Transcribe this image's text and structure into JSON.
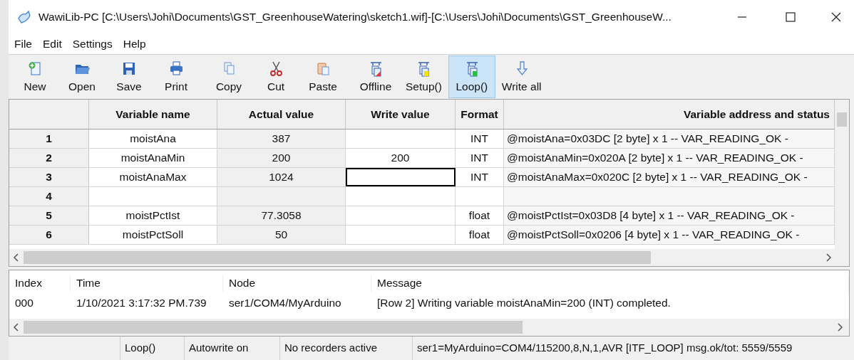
{
  "window": {
    "title": "WawiLib-PC [C:\\Users\\Johi\\Documents\\GST_GreenhouseWatering\\sketch1.wif]-[C:\\Users\\Johi\\Documents\\GST_GreenhouseW..."
  },
  "menu": [
    "File",
    "Edit",
    "Settings",
    "Help"
  ],
  "toolbar": [
    {
      "label": "New",
      "kind": "new",
      "selected": false
    },
    {
      "label": "Open",
      "kind": "open",
      "selected": false
    },
    {
      "label": "Save",
      "kind": "save",
      "selected": false
    },
    {
      "label": "Print",
      "kind": "print",
      "selected": false
    },
    {
      "label": "Copy",
      "kind": "copy",
      "selected": false
    },
    {
      "label": "Cut",
      "kind": "cut",
      "selected": false
    },
    {
      "label": "Paste",
      "kind": "paste",
      "selected": false
    },
    {
      "label": "Offline",
      "kind": "offline",
      "selected": false
    },
    {
      "label": "Setup()",
      "kind": "setup",
      "selected": false
    },
    {
      "label": "Loop()",
      "kind": "loop",
      "selected": true
    },
    {
      "label": "Write all",
      "kind": "writeall",
      "selected": false
    }
  ],
  "table": {
    "columns": [
      "Variable name",
      "Actual value",
      "Write value",
      "Format",
      "Variable address and status"
    ],
    "rows": [
      {
        "index": "1",
        "name": "moistAna",
        "actual": "387",
        "write": "",
        "write_focused": false,
        "format": "INT",
        "address": "@moistAna=0x03DC [2 byte] x 1 -- VAR_READING_OK -"
      },
      {
        "index": "2",
        "name": "moistAnaMin",
        "actual": "200",
        "write": "200",
        "write_focused": false,
        "format": "INT",
        "address": "@moistAnaMin=0x020A [2 byte] x 1 -- VAR_READING_OK -"
      },
      {
        "index": "3",
        "name": "moistAnaMax",
        "actual": "1024",
        "write": "",
        "write_focused": true,
        "format": "INT",
        "address": "@moistAnaMax=0x020C [2 byte] x 1 -- VAR_READING_OK -"
      },
      {
        "index": "4",
        "name": "",
        "actual": "",
        "write": "",
        "write_focused": false,
        "format": "",
        "address": ""
      },
      {
        "index": "5",
        "name": "moistPctIst",
        "actual": "77.3058",
        "write": "",
        "write_focused": false,
        "format": "float",
        "address": "@moistPctIst=0x03D8 [4 byte] x 1 -- VAR_READING_OK -"
      },
      {
        "index": "6",
        "name": "moistPctSoll",
        "actual": "50",
        "write": "",
        "write_focused": false,
        "format": "float",
        "address": "@moistPctSoll=0x0206 [4 byte] x 1 -- VAR_READING_OK -"
      }
    ]
  },
  "log": {
    "columns": [
      "Index",
      "Time",
      "Node",
      "Message"
    ],
    "rows": [
      [
        "000",
        "1/10/2021 3:17:32 PM.739",
        "ser1/COM4/MyArduino",
        "[Row 2] Writing variable moistAnaMin=200 (INT) completed."
      ]
    ]
  },
  "status_bar": [
    "Loop()",
    "Autowrite on",
    "No recorders active",
    "ser1=MyArduino=COM4/115200,8,N,1,AVR [ITF_LOOP] msg.ok/tot: 5559/5559"
  ]
}
